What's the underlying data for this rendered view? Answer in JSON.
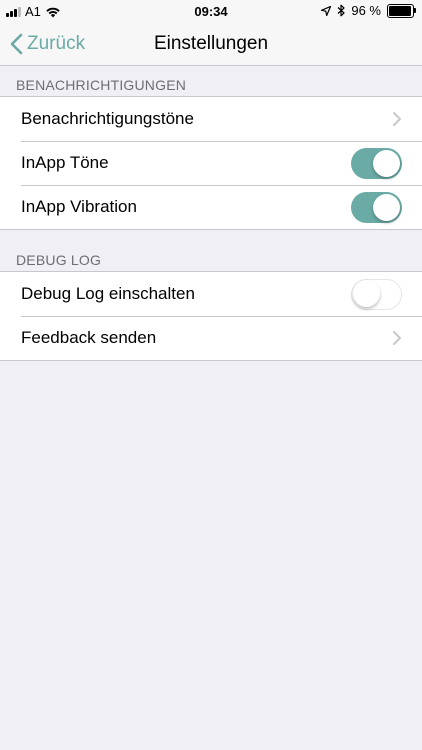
{
  "status_bar": {
    "carrier": "A1",
    "time": "09:34",
    "battery": "96 %"
  },
  "nav": {
    "back_label": "Zurück",
    "title": "Einstellungen"
  },
  "sections": [
    {
      "header": "BENACHRICHTIGUNGEN",
      "rows": [
        {
          "label": "Benachrichtigungstöne",
          "accessory": "chevron"
        },
        {
          "label": "InApp Töne",
          "accessory": "toggle",
          "on": true
        },
        {
          "label": "InApp Vibration",
          "accessory": "toggle",
          "on": true
        }
      ]
    },
    {
      "header": "DEBUG LOG",
      "rows": [
        {
          "label": "Debug Log einschalten",
          "accessory": "toggle",
          "on": false
        },
        {
          "label": "Feedback senden",
          "accessory": "chevron"
        }
      ]
    }
  ],
  "colors": {
    "accent": "#6aaba5",
    "background": "#efeff4"
  }
}
